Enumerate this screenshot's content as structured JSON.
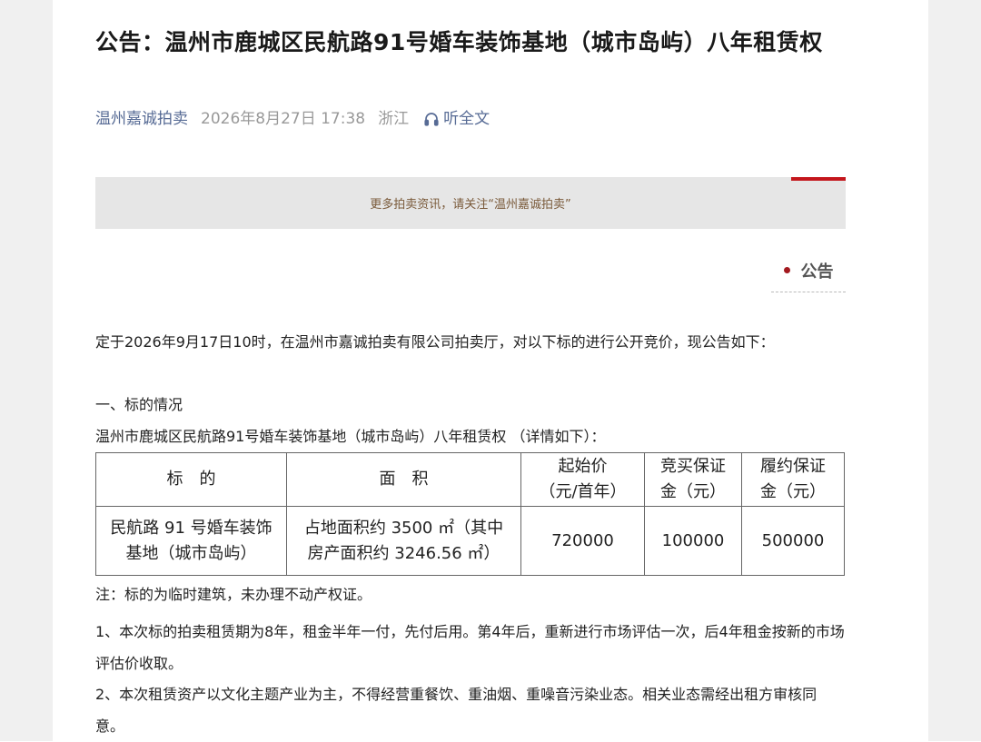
{
  "article": {
    "title": "公告：温州市鹿城区民航路91号婚车装饰基地（城市岛屿）八年租赁权",
    "account": "温州嘉诚拍卖",
    "datetime": "2026年8月27日 17:38",
    "region": "浙江",
    "listen_label": "听全文"
  },
  "banner": {
    "text": "更多拍卖资讯，请关注“温州嘉诚拍卖”"
  },
  "section": {
    "label": "公告"
  },
  "body": {
    "intro": "定于2026年9月17日10时，在温州市嘉诚拍卖有限公司拍卖厅，对以下标的进行公开竞价，现公告如下：",
    "heading1": "一、标的情况",
    "subject_line": "温州市鹿城区民航路91号婚车装饰基地（城市岛屿）八年租赁权 （详情如下）：",
    "table": {
      "headers": [
        "标　的",
        "面　积",
        "起始价\n（元/首年）",
        "竞买保证\n金（元）",
        "履约保证\n金（元）"
      ],
      "row": [
        "民航路 91 号婚车装饰\n基地（城市岛屿）",
        "占地面积约 3500 ㎡（其中\n房产面积约 3246.56 ㎡）",
        "720000",
        "100000",
        "500000"
      ]
    },
    "note": "注：标的为临时建筑，未办理不动产权证。",
    "item1": "1、本次标的拍卖租赁期为8年，租金半年一付，先付后用。第4年后，重新进行市场评估一次，后4年租金按新的市场评估价收取。",
    "item2": "2、本次租赁资产以文化主题产业为主，不得经营重餐饮、重油烟、重噪音污染业态。相关业态需经出租方审核同意。"
  }
}
